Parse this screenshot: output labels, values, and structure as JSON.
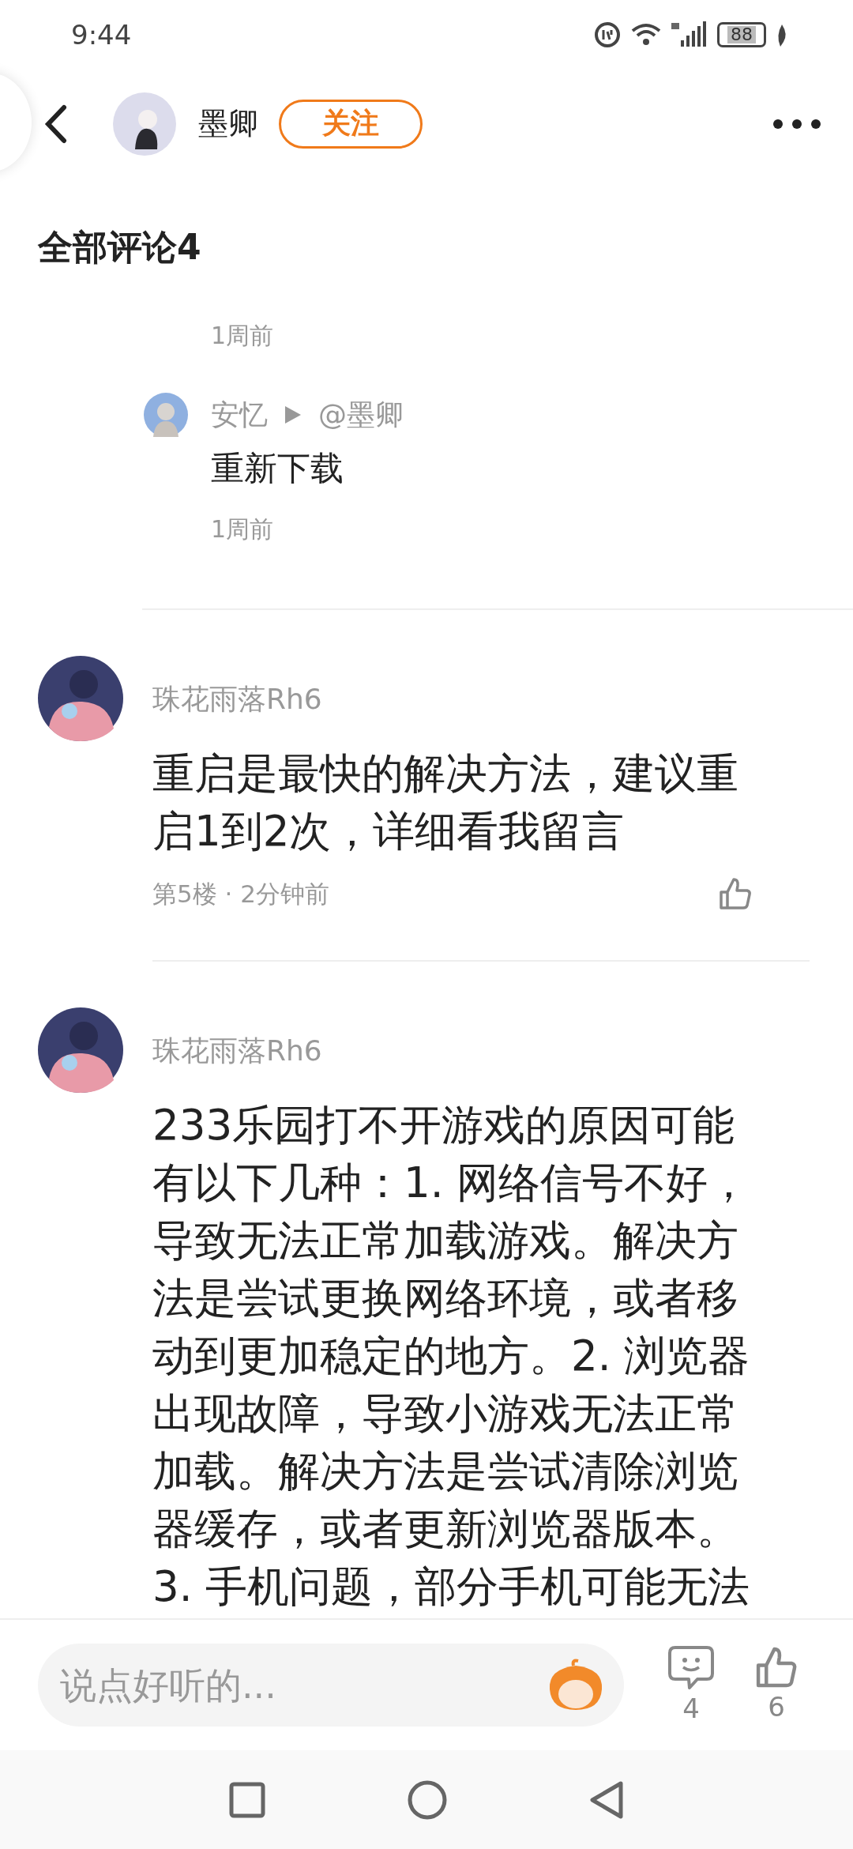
{
  "status_bar": {
    "time": "9:44",
    "battery": "88"
  },
  "header": {
    "author": "墨卿",
    "follow_label": "关注"
  },
  "section_title": "全部评论4",
  "top_time": "1周前",
  "replies": [
    {
      "name": "安忆",
      "target": "@墨卿",
      "text": "重新下载",
      "time": "1周前"
    }
  ],
  "comments": [
    {
      "name": "珠花雨落Rh6",
      "text": "重启是最快的解决方法，建议重启1到2次，详细看我留言",
      "meta": "第5楼 · 2分钟前"
    },
    {
      "name": "珠花雨落Rh6",
      "text": "233乐园打不开游戏的原因可能有以下几种：1. 网络信号不好，导致无法正常加载游戏。解决方法是尝试更换网络环境，或者移动到更加稳定的地方。2. 浏览器出现故障，导致小游戏无法正常加载。解决方法是尝试清除浏览器缓存，或者更新浏览器版本。3. 手机问题，部分手机可能无法"
    }
  ],
  "composer": {
    "placeholder": "说点好听的..."
  },
  "actions": [
    {
      "kind": "comment",
      "count": "4"
    },
    {
      "kind": "like",
      "count": "6"
    }
  ]
}
